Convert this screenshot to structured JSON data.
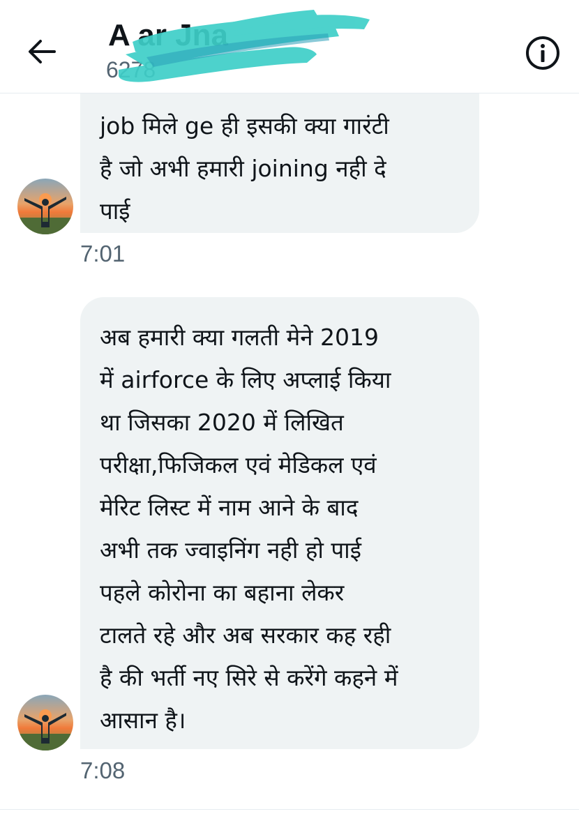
{
  "header": {
    "name": "A          ar Jna",
    "handle": "                    6278",
    "back_icon": "arrow-left-icon",
    "info_icon": "info-icon"
  },
  "messages": [
    {
      "text": "job मिले ge ही इसकी क्या गारंटी\nहै जो अभी हमारी joining नही दे\nपाई",
      "time": "7:01"
    },
    {
      "text": "अब हमारी क्या गलती  मेने 2019\nमें airforce के लिए अप्लाई किया\nथा जिसका 2020  में लिखित\nपरीक्षा,फिजिकल एवं मेडिकल एवं\nमेरिट लिस्ट में नाम आने के बाद\nअभी तक ज्वाइनिंग नही हो पाई\nपहले कोरोना का बहाना लेकर\nटालते रहे और अब सरकार कह रही\nहै की भर्ती नए सिरे से करेंगे कहने में\nआसान है।",
      "time": "7:08"
    }
  ],
  "colors": {
    "bubble": "#eff3f4",
    "text": "#0f1419",
    "muted": "#536471",
    "scribble": "#3ecfc8"
  }
}
